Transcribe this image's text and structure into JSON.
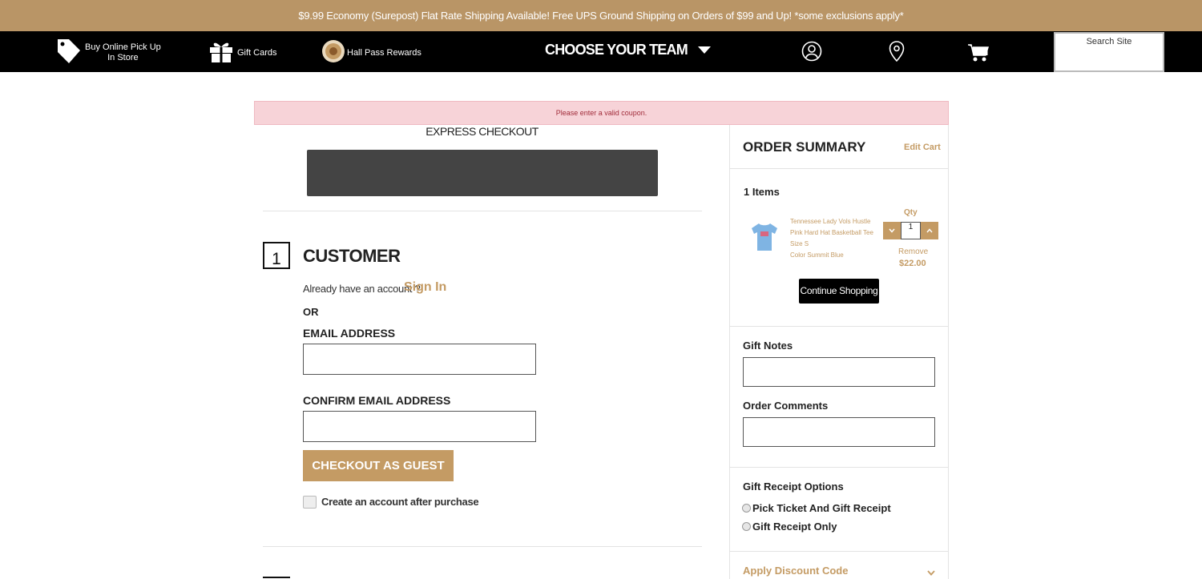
{
  "promo": {
    "text": "$9.99 Economy (Surepost) Flat Rate Shipping Available! Free UPS Ground Shipping on Orders of $99 and Up! *some exclusions apply*"
  },
  "nav": {
    "pickup_line1": "Buy Online Pick Up",
    "pickup_line2": "In Store",
    "gift_cards": "Gift Cards",
    "hall_pass": "Hall Pass Rewards",
    "choose_team": "CHOOSE YOUR TEAM",
    "search_placeholder": "Search Site"
  },
  "alert": {
    "text": "Please enter a valid coupon."
  },
  "express": {
    "title": "EXPRESS CHECKOUT"
  },
  "customer": {
    "step": "1",
    "title": "CUSTOMER",
    "have_account": "Already have an account ?",
    "sign_in": "Sign In",
    "or": "OR",
    "email_label": "EMAIL ADDRESS",
    "confirm_email_label": "CONFIRM EMAIL ADDRESS",
    "email_value": "",
    "confirm_email_value": "",
    "guest_button": "CHECKOUT AS GUEST",
    "create_account": "Create an account after purchase"
  },
  "summary": {
    "title": "ORDER SUMMARY",
    "edit_cart": "Edit Cart",
    "items_count": "1 Items",
    "product": {
      "name": "Tennessee Lady Vols Hustle Pink Hard Hat Basketball Tee",
      "size": "Size S",
      "color": "Color Summit Blue",
      "qty_label": "Qty",
      "qty": "1",
      "remove": "Remove",
      "price": "$22.00"
    },
    "continue_shopping": "Continue Shopping",
    "gift_notes_label": "Gift Notes",
    "order_comments_label": "Order Comments",
    "gift_receipt_label": "Gift Receipt Options",
    "receipt_options": [
      "Pick Ticket And Gift Receipt",
      "Gift Receipt Only"
    ],
    "discount_label": "Apply Discount Code"
  },
  "colors": {
    "brand_gold": "#b99566",
    "accent_gold": "#c49b64",
    "nav_black": "#000000",
    "alert_bg": "#f7d3d8"
  }
}
